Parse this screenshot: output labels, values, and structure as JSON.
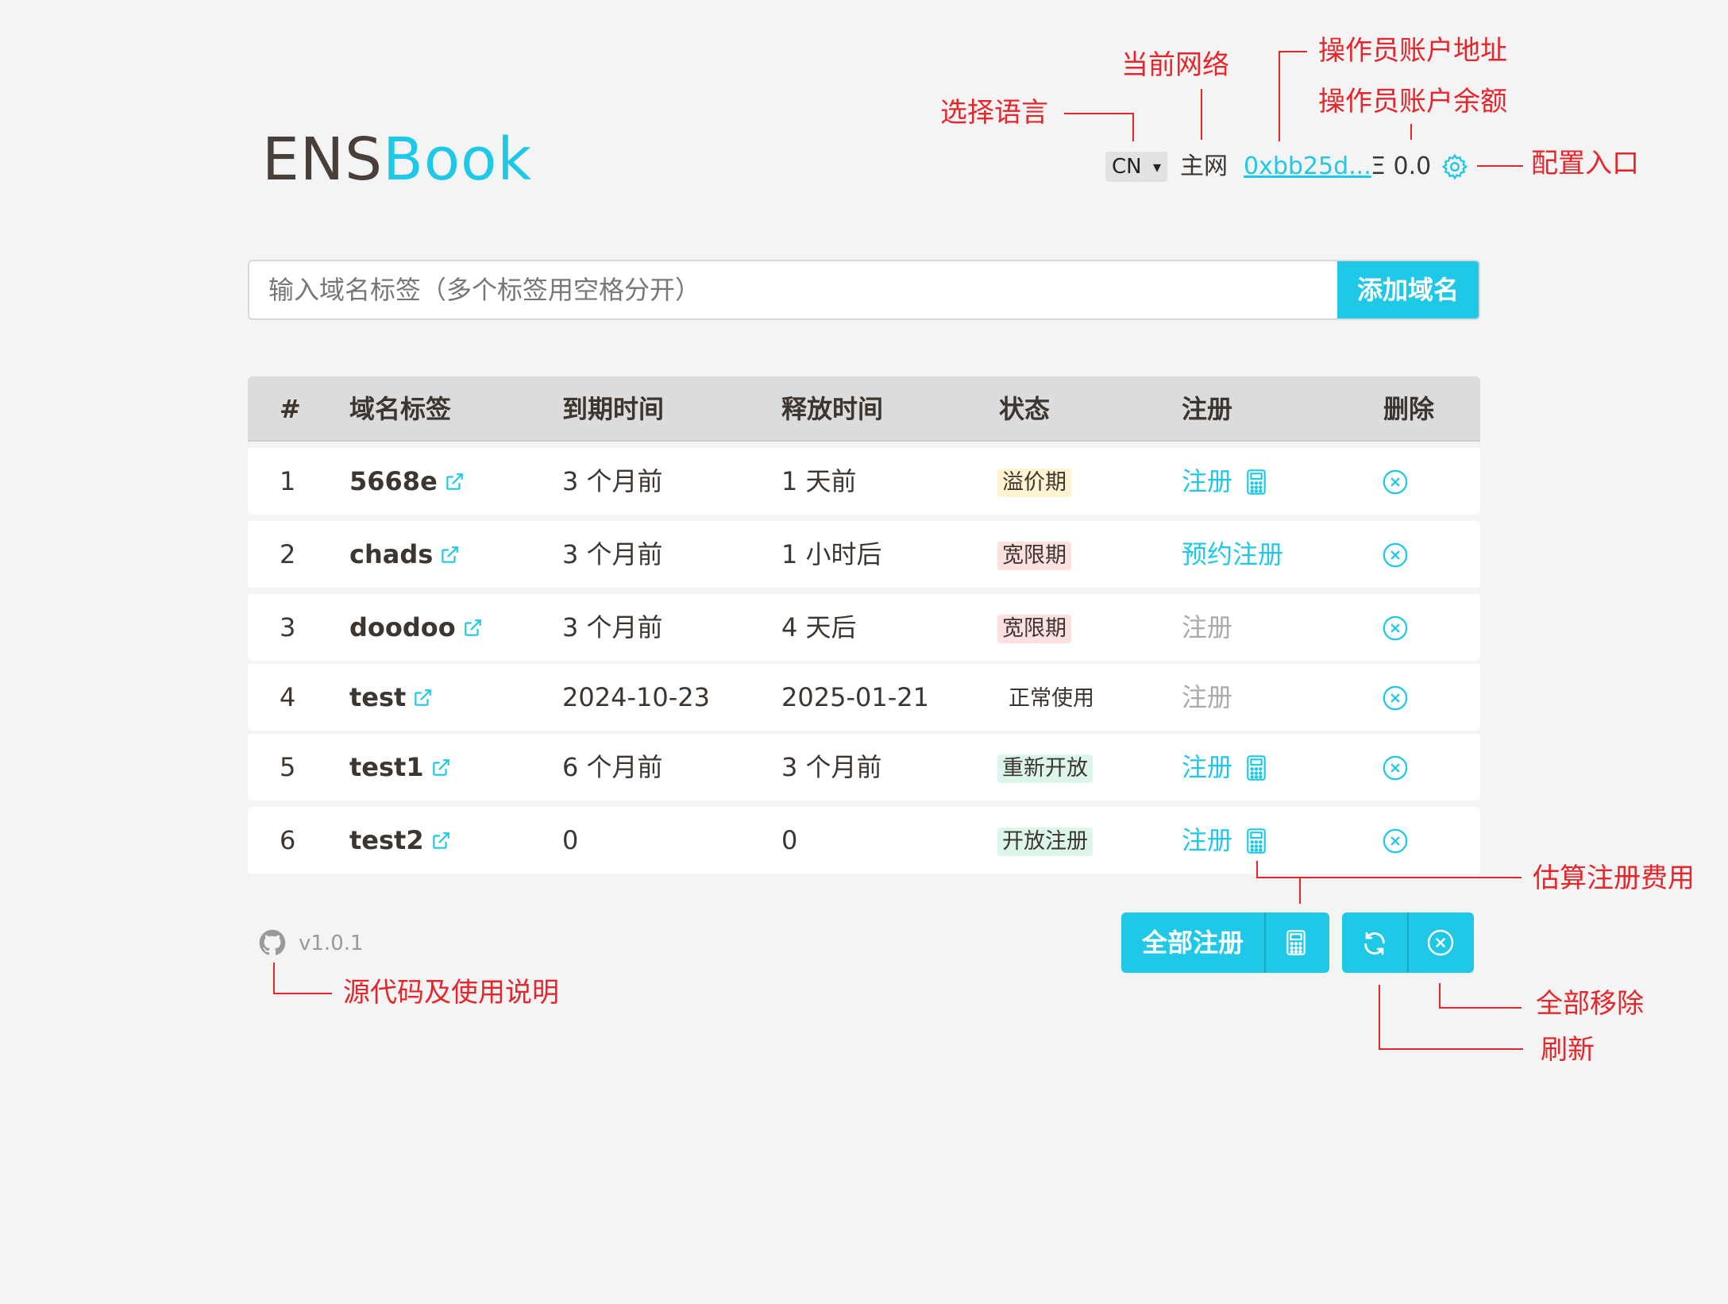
{
  "logo": {
    "part1": "ENS",
    "part2": "Book"
  },
  "header": {
    "language": "CN",
    "network": "主网",
    "account": "0xbb25d...",
    "balance": "Ξ 0.0"
  },
  "search": {
    "placeholder": "输入域名标签（多个标签用空格分开）",
    "add_button": "添加域名"
  },
  "table": {
    "headers": [
      "#",
      "域名标签",
      "到期时间",
      "释放时间",
      "状态",
      "注册",
      "删除"
    ],
    "rows": [
      {
        "index": "1",
        "label": "5668e",
        "expiry": "3 个月前",
        "release": "1 天前",
        "status": "溢价期",
        "register": "注册"
      },
      {
        "index": "2",
        "label": "chads",
        "expiry": "3 个月前",
        "release": "1 小时后",
        "status": "宽限期",
        "register": "预约注册"
      },
      {
        "index": "3",
        "label": "doodoo",
        "expiry": "3 个月前",
        "release": "4 天后",
        "status": "宽限期",
        "register": "注册"
      },
      {
        "index": "4",
        "label": "test",
        "expiry": "2024-10-23",
        "release": "2025-01-21",
        "status": "正常使用",
        "register": "注册"
      },
      {
        "index": "5",
        "label": "test1",
        "expiry": "6 个月前",
        "release": "3 个月前",
        "status": "重新开放",
        "register": "注册"
      },
      {
        "index": "6",
        "label": "test2",
        "expiry": "0",
        "release": "0",
        "status": "开放注册",
        "register": "注册"
      }
    ]
  },
  "footer": {
    "version": "v1.0.1",
    "register_all": "全部注册"
  },
  "annotations": {
    "select_language": "选择语言",
    "current_network": "当前网络",
    "operator_address": "操作员账户地址",
    "operator_balance": "操作员账户余额",
    "config_entry": "配置入口",
    "estimate_fee": "估算注册费用",
    "remove_all": "全部移除",
    "refresh": "刷新",
    "source_docs": "源代码及使用说明"
  },
  "colors": {
    "accent": "#1ec8e6",
    "annotation": "#e6262b",
    "text": "#3d3530"
  }
}
